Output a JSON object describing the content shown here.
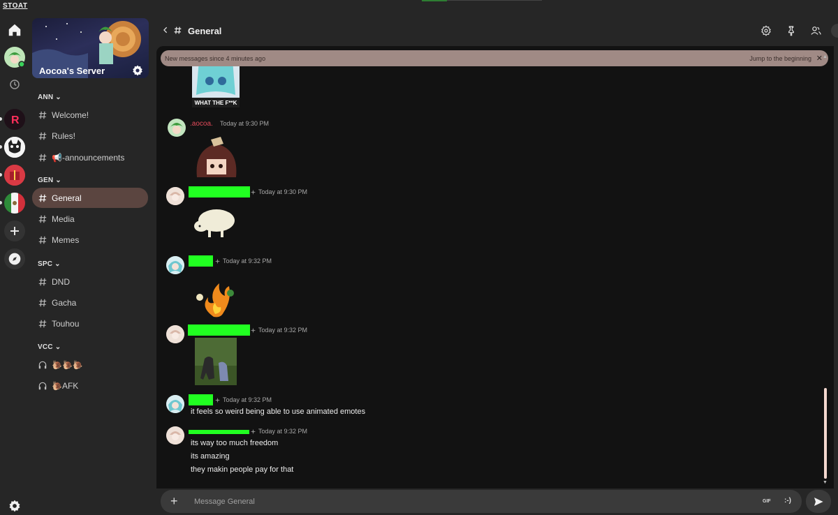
{
  "app": {
    "brand": "STOAT"
  },
  "server": {
    "name": "Aocoa's Server"
  },
  "categories": [
    {
      "label": "ANN",
      "channels": [
        "Welcome!",
        "Rules!",
        "📢-announcements"
      ]
    },
    {
      "label": "GEN",
      "channels": [
        "General",
        "Media",
        "Memes"
      ]
    },
    {
      "label": "SPC",
      "channels": [
        "DND",
        "Gacha",
        "Touhou"
      ]
    },
    {
      "label": "VCC",
      "voice": [
        "🐌🐌🐌",
        "🐌AFK"
      ]
    }
  ],
  "header": {
    "title": "General"
  },
  "banner": {
    "text": "New messages since 4 minutes ago",
    "jump": "Jump to the beginning"
  },
  "messages": [
    {
      "user": ".aocoa.",
      "time": "Today at 9:30 PM"
    },
    {
      "time": "Today at 9:30 PM"
    },
    {
      "time": "Today at 9:32 PM"
    },
    {
      "time": "Today at 9:32 PM"
    },
    {
      "time": "Today at 9:32 PM",
      "text": [
        "it feels so weird being able to use animated emotes"
      ]
    },
    {
      "time": "Today at 9:32 PM",
      "text": [
        "its way too much freedom",
        "its amazing",
        "they makin people pay for that"
      ]
    }
  ],
  "emote_captions": {
    "first": "WHAT THE F**K"
  },
  "composer": {
    "placeholder": "Message General",
    "gif": "GIF",
    "emoji": ":-)"
  },
  "colors": {
    "accent": "#5b4540",
    "redacted": "#21ff21",
    "username_red": "#e34a5a",
    "banner": "#a08a85"
  },
  "icons": [
    "home-icon",
    "history-icon",
    "add-server-icon",
    "compass-icon",
    "settings-icon",
    "hash-icon",
    "headphones-icon",
    "gear-icon",
    "pin-icon",
    "members-icon",
    "back-icon",
    "send-icon"
  ]
}
